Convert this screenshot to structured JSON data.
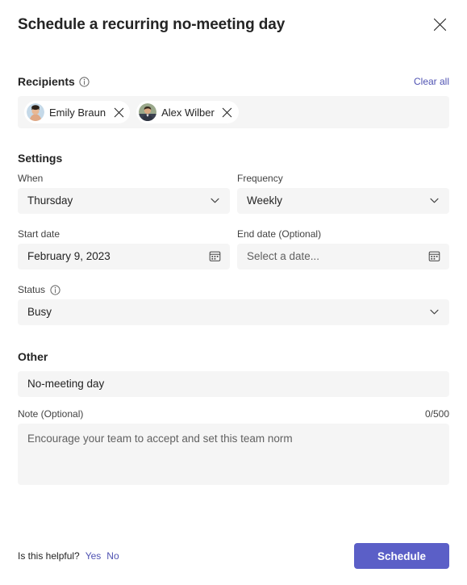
{
  "dialog": {
    "title": "Schedule a recurring no-meeting day",
    "close_icon": "close-icon"
  },
  "recipients": {
    "label": "Recipients",
    "info_icon": "info-icon",
    "clear_all": "Clear all",
    "chips": [
      {
        "name": "Emily Braun",
        "remove_icon": "close-icon"
      },
      {
        "name": "Alex Wilber",
        "remove_icon": "close-icon"
      }
    ]
  },
  "settings": {
    "title": "Settings",
    "when": {
      "label": "When",
      "value": "Thursday",
      "icon": "chevron-down-icon"
    },
    "frequency": {
      "label": "Frequency",
      "value": "Weekly",
      "icon": "chevron-down-icon"
    },
    "start_date": {
      "label": "Start date",
      "value": "February 9, 2023",
      "icon": "calendar-icon"
    },
    "end_date": {
      "label": "End date (Optional)",
      "value": "",
      "placeholder": "Select a date...",
      "icon": "calendar-icon"
    },
    "status": {
      "label": "Status",
      "info_icon": "info-icon",
      "value": "Busy",
      "icon": "chevron-down-icon"
    }
  },
  "other": {
    "title": "Other",
    "subject": {
      "value": "No-meeting day"
    },
    "note": {
      "label": "Note (Optional)",
      "counter": "0/500",
      "value": "",
      "placeholder": "Encourage your team to accept and set this team norm"
    }
  },
  "footer": {
    "helpful_text": "Is this helpful?",
    "yes_label": "Yes",
    "no_label": "No",
    "submit_label": "Schedule"
  },
  "colors": {
    "accent": "#5b5fc7",
    "link": "#4f52b2",
    "field_bg": "#f5f5f5",
    "text": "#242424",
    "muted_text": "#616161"
  }
}
